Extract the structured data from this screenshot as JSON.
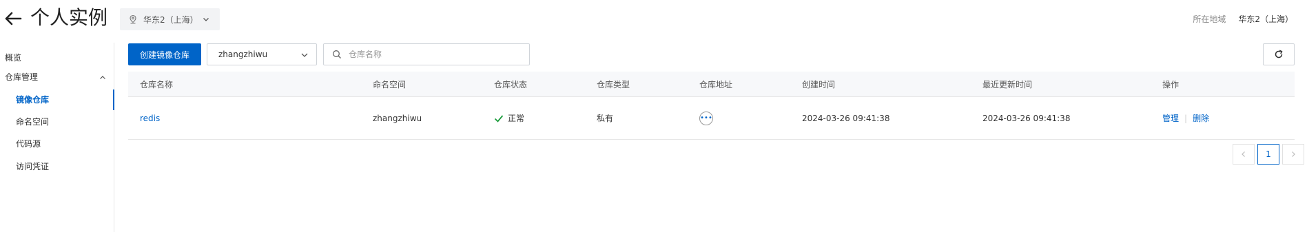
{
  "header": {
    "title": "个人实例",
    "region_selector": "华东2（上海）",
    "region_label": "所在地域",
    "region_value": "华东2（上海）"
  },
  "sidebar": {
    "items": [
      {
        "label": "概览"
      },
      {
        "label": "仓库管理"
      },
      {
        "label": "镜像仓库",
        "active": true
      },
      {
        "label": "命名空间"
      },
      {
        "label": "代码源"
      },
      {
        "label": "访问凭证"
      }
    ]
  },
  "toolbar": {
    "create_label": "创建镜像仓库",
    "namespace_value": "zhangzhiwu",
    "search_placeholder": "仓库名称"
  },
  "table": {
    "columns": [
      "仓库名称",
      "命名空间",
      "仓库状态",
      "仓库类型",
      "仓库地址",
      "创建时间",
      "最近更新时间",
      "操作"
    ],
    "rows": [
      {
        "name": "redis",
        "namespace": "zhangzhiwu",
        "status": "正常",
        "type": "私有",
        "created": "2024-03-26 09:41:38",
        "updated": "2024-03-26 09:41:38",
        "actions": [
          "管理",
          "删除"
        ]
      }
    ]
  },
  "pagination": {
    "current": "1"
  },
  "colors": {
    "accent": "#0064c8",
    "success": "#1b9b3c"
  }
}
